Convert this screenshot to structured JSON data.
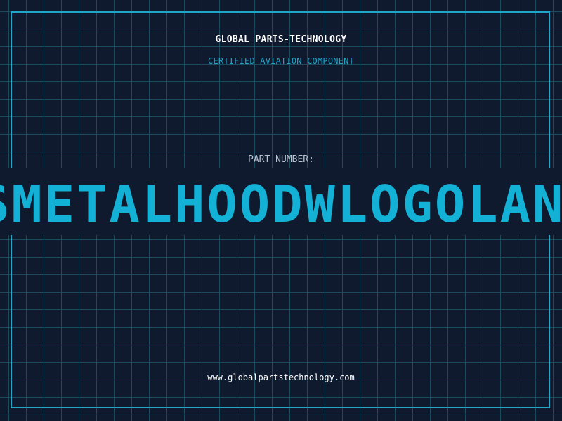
{
  "header": {
    "brand": "GLOBAL PARTS-TECHNOLOGY",
    "subtitle": "CERTIFIED AVIATION COMPONENT"
  },
  "part": {
    "label": "PART NUMBER:",
    "number": "SMETALHOODWLOGOLAN"
  },
  "footer": {
    "url": "www.globalpartstechnology.com"
  },
  "colors": {
    "background": "#0f1a2e",
    "grid": "#1d4a5e",
    "accent": "#1fa6c9",
    "part_number": "#14b1d6",
    "text": "#ffffff",
    "label": "#b7c3d3"
  }
}
